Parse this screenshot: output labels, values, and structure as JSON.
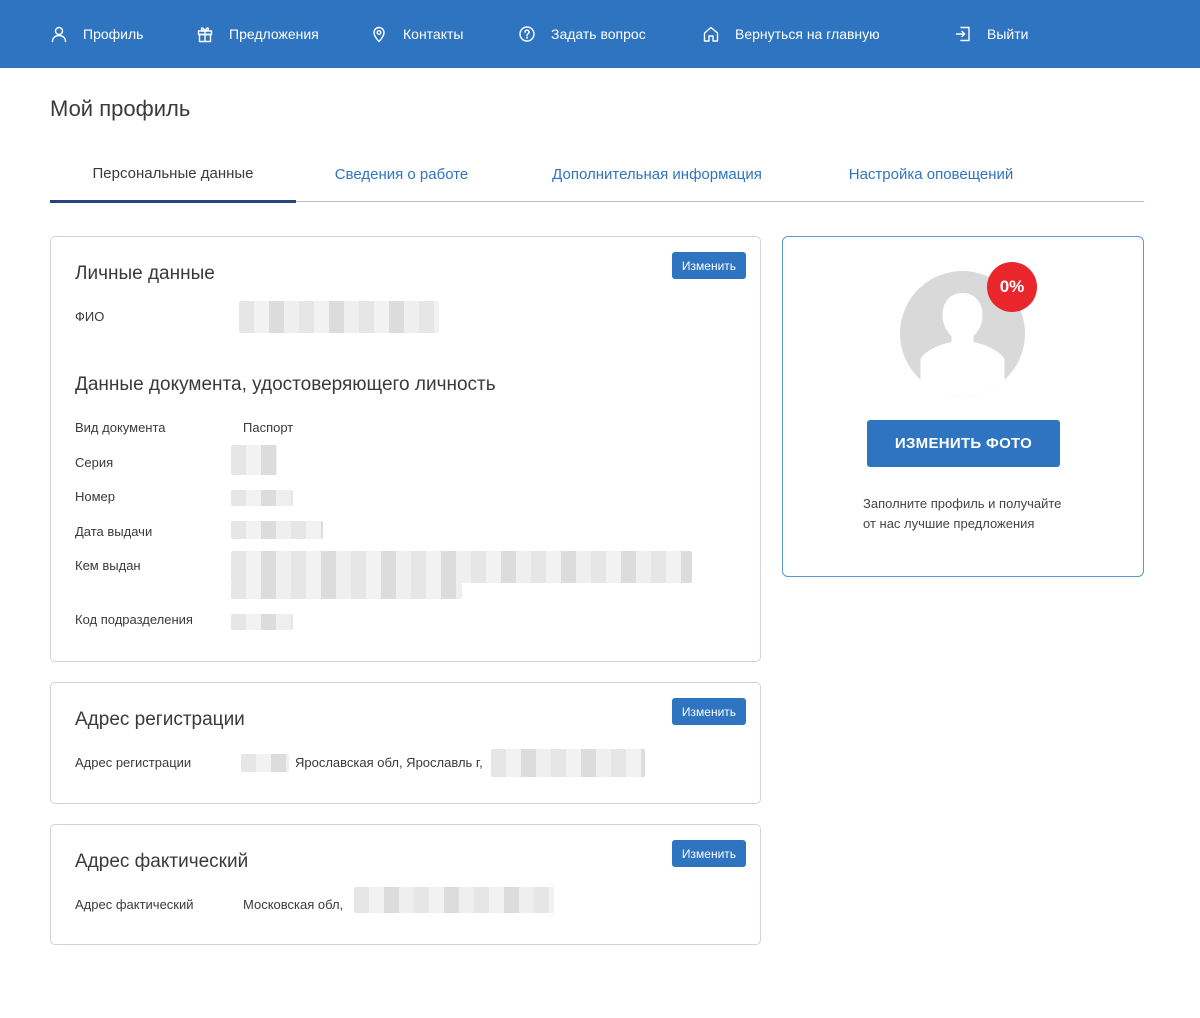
{
  "nav": {
    "profile": "Профиль",
    "offers": "Предложения",
    "contacts": "Контакты",
    "ask": "Задать вопрос",
    "home": "Вернуться на главную",
    "logout": "Выйти"
  },
  "page_title": "Мой профиль",
  "tabs": {
    "personal": "Персональные данные",
    "work": "Сведения о работе",
    "extra": "Дополнительная информация",
    "notifications": "Настройка оповещений"
  },
  "personal_card": {
    "title": "Личные данные",
    "edit": "Изменить",
    "fio_label": "ФИО",
    "doc_title": "Данные документа, удостоверяющего личность",
    "doc_type_label": "Вид документа",
    "doc_type_value": "Паспорт",
    "series_label": "Серия",
    "number_label": "Номер",
    "issue_date_label": "Дата выдачи",
    "issued_by_label": "Кем выдан",
    "dept_code_label": "Код подразделения"
  },
  "reg_card": {
    "title": "Адрес регистрации",
    "edit": "Изменить",
    "label": "Адрес регистрации",
    "value": "Ярославская обл, Ярославль г,"
  },
  "actual_card": {
    "title": "Адрес фактический",
    "edit": "Изменить",
    "label": "Адрес фактический",
    "value": "Московская обл,"
  },
  "photo": {
    "progress": "0%",
    "button": "ИЗМЕНИТЬ ФОТО",
    "hint": "Заполните профиль и получайте от нас лучшие предложения"
  },
  "colors": {
    "brand": "#2f74c0",
    "badge": "#e8262b",
    "tab_active_underline": "#27447a"
  }
}
